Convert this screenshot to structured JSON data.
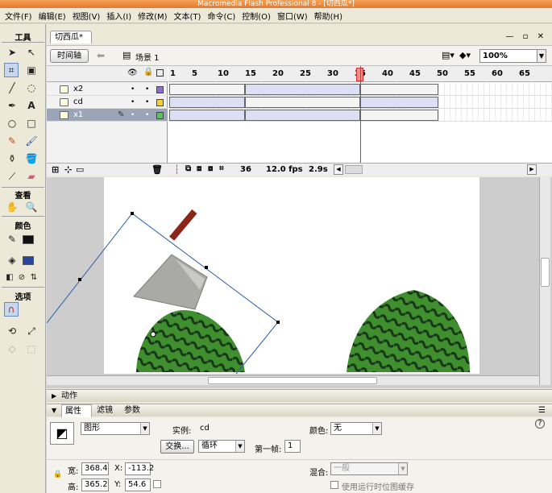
{
  "title": "Macromedia Flash Professional 8 - [切西瓜*]",
  "menu": [
    "文件(F)",
    "编辑(E)",
    "视图(V)",
    "插入(I)",
    "修改(M)",
    "文本(T)",
    "命令(C)",
    "控制(O)",
    "窗口(W)",
    "帮助(H)"
  ],
  "tools": {
    "header": "工具",
    "view_header": "查看",
    "color_header": "颜色",
    "options_header": "选项"
  },
  "document": {
    "tab_label": "切西瓜*",
    "timeline_button": "时间轴",
    "scene_label": "场景 1",
    "zoom": "100%"
  },
  "timeline": {
    "frame_numbers": [
      "1",
      "5",
      "10",
      "15",
      "20",
      "25",
      "30",
      "35",
      "40",
      "45",
      "50",
      "55",
      "60",
      "65"
    ],
    "layers": [
      {
        "name": "x2",
        "swatch": "#8a6fd0"
      },
      {
        "name": "cd",
        "swatch": "#f2d22c"
      },
      {
        "name": "x1",
        "swatch": "#5fbf5f"
      }
    ],
    "current_frame": "36",
    "fps": "12.0 fps",
    "time": "2.9s"
  },
  "panels": {
    "actions_label": "动作",
    "tabs": [
      "属性",
      "滤镜",
      "参数"
    ]
  },
  "properties": {
    "symbol_type": "图形",
    "instance_label": "实例:",
    "instance_name": "cd",
    "swap_button": "交换...",
    "loop_mode": "循环",
    "first_frame_label": "第一帧:",
    "first_frame": "1",
    "color_label": "颜色:",
    "color_value": "无",
    "width_label": "宽:",
    "width": "368.4",
    "height_label": "高:",
    "height": "365.2",
    "x_label": "X:",
    "x": "-113.2",
    "y_label": "Y:",
    "y": "54.6",
    "blend_label": "混合:",
    "blend_value": "一般",
    "runtime_bitmap_label": "使用运行时位图缓存",
    "help_icon": "?"
  }
}
